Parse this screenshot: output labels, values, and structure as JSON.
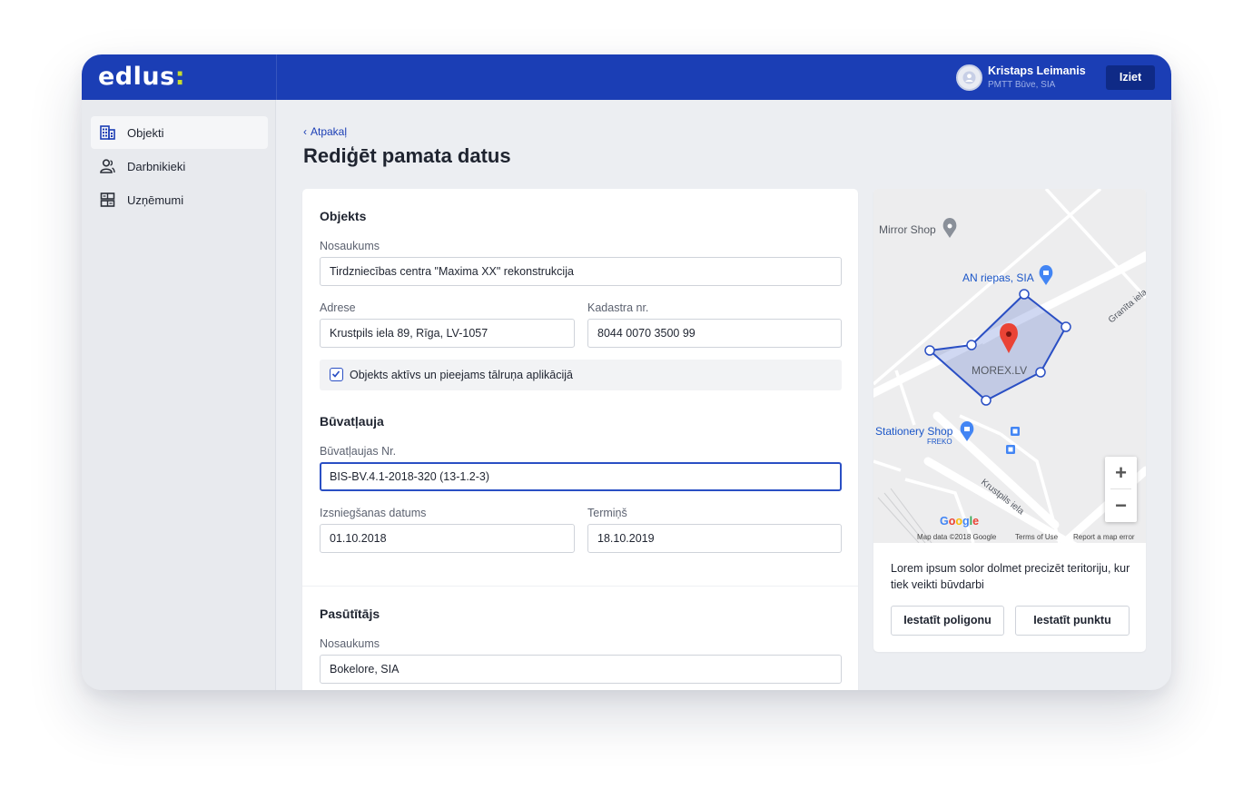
{
  "app": {
    "logo_text": "edlus",
    "logo_colon": ":",
    "brand_color": "#1b3eb5",
    "accent_color": "#c8dc2f"
  },
  "header": {
    "user_name": "Kristaps Leimanis",
    "user_company": "PMTT Būve, SIA",
    "logout_label": "Iziet"
  },
  "sidebar": {
    "items": [
      {
        "label": "Objekti",
        "icon": "building-icon",
        "active": true
      },
      {
        "label": "Darbnikieki",
        "icon": "users-icon",
        "active": false
      },
      {
        "label": "Uzņēmumi",
        "icon": "companies-icon",
        "active": false
      }
    ]
  },
  "page": {
    "back_label": "Atpakaļ",
    "title": "Rediģēt pamata datus"
  },
  "form": {
    "object_section": "Objekts",
    "name_label": "Nosaukums",
    "name_value": "Tirdzniecības centra \"Maxima XX\" rekonstrukcija",
    "address_label": "Adrese",
    "address_value": "Krustpils iela 89, Rīga, LV-1057",
    "cadastre_label": "Kadastra nr.",
    "cadastre_value": "8044 0070 3500 99",
    "active_checkbox_label": "Objekts aktīvs un pieejams tālruņa aplikācijā",
    "active_checked": true,
    "permit_section": "Būvatļauja",
    "permit_no_label": "Būvatļaujas Nr.",
    "permit_no_value": "BIS-BV.4.1-2018-320 (13-1.2-3)",
    "issue_date_label": "Izsniegšanas datums",
    "issue_date_value": "01.10.2018",
    "deadline_label": "Termiņš",
    "deadline_value": "18.10.2019",
    "client_section": "Pasūtītājs",
    "client_name_label": "Nosaukums",
    "client_name_value": "Bokelore, SIA"
  },
  "map": {
    "places": {
      "mirror_shop": "Mirror Shop",
      "an_riepas": "AN riepas, SIA",
      "morex": "MOREX.LV",
      "stationery_shop": "Stationery Shop",
      "freko": "FREKO",
      "krustpils_street": "Krustpils iela",
      "granita_street": "Granīta iela"
    },
    "google_label": "Google",
    "map_data": "Map data ©2018 Google",
    "terms": "Terms of Use",
    "report": "Report a map error",
    "zoom_in": "+",
    "zoom_out": "−",
    "description": "Lorem ipsum solor dolmet precizēt teritoriju, kur tiek veikti būvdarbi",
    "set_polygon_label": "Iestatīt poligonu",
    "set_point_label": "Iestatīt punktu"
  }
}
